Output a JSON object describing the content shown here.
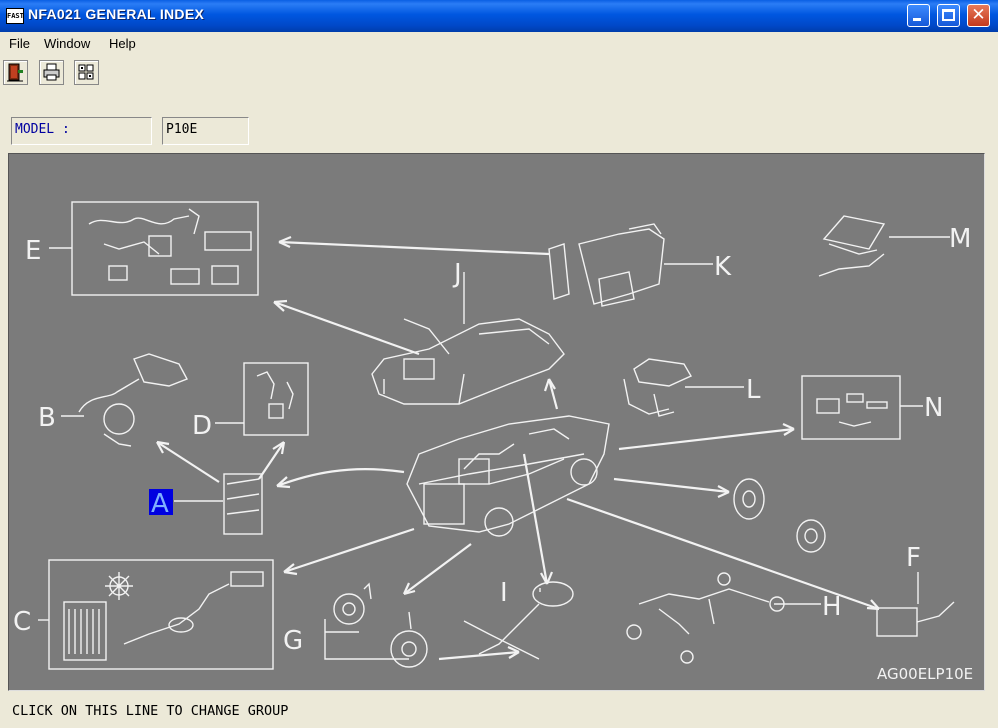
{
  "window": {
    "title": "NFA021 GENERAL INDEX",
    "icon_label": "FAST"
  },
  "menu": {
    "items": [
      "File",
      "Window",
      "Help"
    ]
  },
  "toolbar": {
    "buttons": [
      {
        "icon": "exit-door-icon"
      },
      {
        "icon": "printer-icon"
      },
      {
        "icon": "grid-icon"
      }
    ]
  },
  "model": {
    "label": "MODEL :",
    "value": "P10E"
  },
  "diagram": {
    "group_letters": [
      "A",
      "B",
      "C",
      "D",
      "E",
      "F",
      "G",
      "H",
      "I",
      "J",
      "K",
      "L",
      "M",
      "N"
    ],
    "selected_group": "A",
    "code": "AG00ELP10E"
  },
  "status": {
    "text": "CLICK ON THIS LINE TO CHANGE GROUP"
  },
  "colors": {
    "title_bar": "#0054e3",
    "diagram_bg": "#7b7b7b",
    "selection": "#0000e0",
    "field_text_label": "#0000a0"
  }
}
